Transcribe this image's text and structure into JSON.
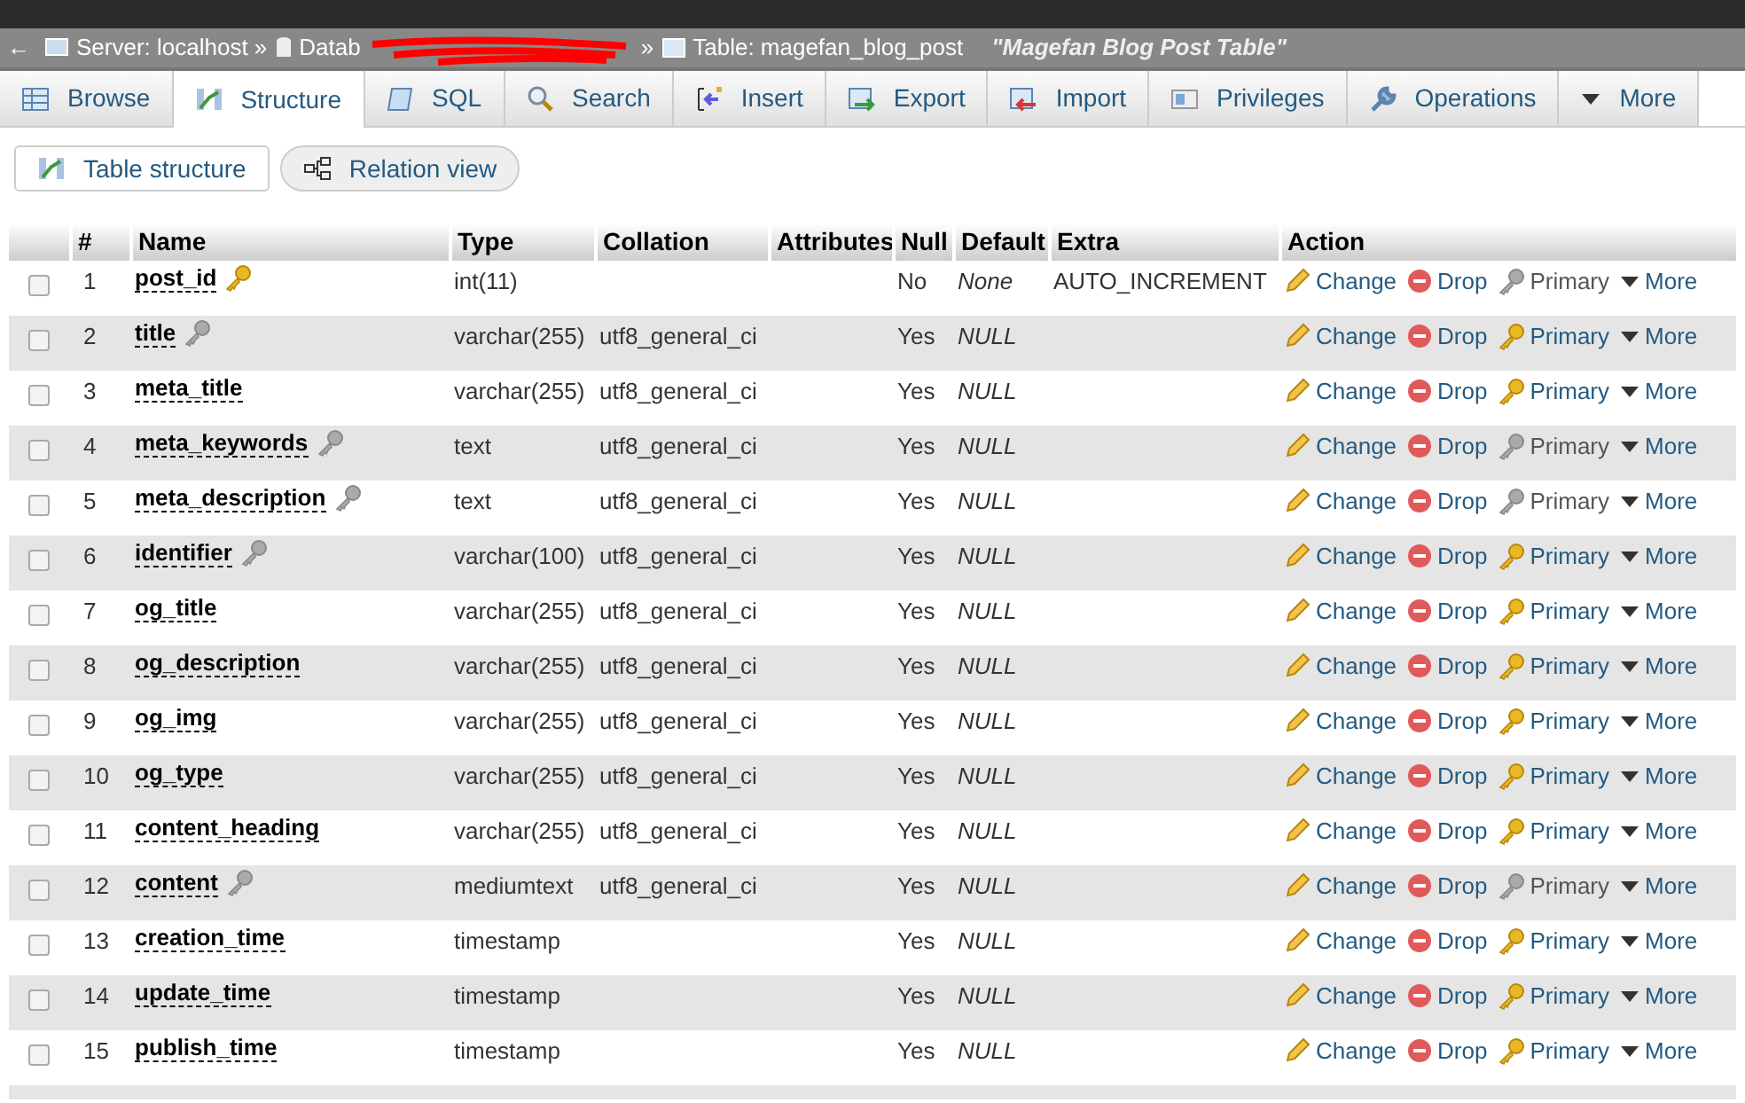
{
  "breadcrumb": {
    "back": "←",
    "server": "Server: localhost »",
    "database": "Datab",
    "separator": "»",
    "table": "Table: magefan_blog_post",
    "comment": "\"Magefan Blog Post Table\""
  },
  "tabs": [
    {
      "label": "Browse",
      "selected": false
    },
    {
      "label": "Structure",
      "selected": true
    },
    {
      "label": "SQL",
      "selected": false
    },
    {
      "label": "Search",
      "selected": false
    },
    {
      "label": "Insert",
      "selected": false
    },
    {
      "label": "Export",
      "selected": false
    },
    {
      "label": "Import",
      "selected": false
    },
    {
      "label": "Privileges",
      "selected": false
    },
    {
      "label": "Operations",
      "selected": false
    },
    {
      "label": "More",
      "selected": false
    }
  ],
  "subtabs": [
    {
      "label": "Table structure",
      "selected": true
    },
    {
      "label": "Relation view",
      "selected": false
    }
  ],
  "table": {
    "columns": [
      "#",
      "Name",
      "Type",
      "Collation",
      "Attributes",
      "Null",
      "Default",
      "Extra",
      "Action"
    ],
    "rows": [
      {
        "num": "1",
        "name": "post_id",
        "kind": "primary",
        "type": "int(11)",
        "collation": "",
        "null": "No",
        "default": "None",
        "extra": "AUTO_INCREMENT",
        "primary_enabled": false,
        "checked": false,
        "actions": [
          "Change",
          "Drop",
          "Primary",
          "More"
        ]
      },
      {
        "num": "2",
        "name": "title",
        "kind": "indexed",
        "type": "varchar(255)",
        "collation": "utf8_general_ci",
        "null": "Yes",
        "default": "NULL",
        "extra": "",
        "primary_enabled": true,
        "checked": false,
        "actions": [
          "Change",
          "Drop",
          "Primary",
          "More"
        ]
      },
      {
        "num": "3",
        "name": "meta_title",
        "kind": "plain",
        "type": "varchar(255)",
        "collation": "utf8_general_ci",
        "null": "Yes",
        "default": "NULL",
        "extra": "",
        "primary_enabled": true,
        "checked": false,
        "actions": [
          "Change",
          "Drop",
          "Primary",
          "More"
        ]
      },
      {
        "num": "4",
        "name": "meta_keywords",
        "kind": "indexed",
        "type": "text",
        "collation": "utf8_general_ci",
        "null": "Yes",
        "default": "NULL",
        "extra": "",
        "primary_enabled": false,
        "checked": false,
        "actions": [
          "Change",
          "Drop",
          "Primary",
          "More"
        ]
      },
      {
        "num": "5",
        "name": "meta_description",
        "kind": "indexed",
        "type": "text",
        "collation": "utf8_general_ci",
        "null": "Yes",
        "default": "NULL",
        "extra": "",
        "primary_enabled": false,
        "checked": false,
        "actions": [
          "Change",
          "Drop",
          "Primary",
          "More"
        ]
      },
      {
        "num": "6",
        "name": "identifier",
        "kind": "indexed",
        "type": "varchar(100)",
        "collation": "utf8_general_ci",
        "null": "Yes",
        "default": "NULL",
        "extra": "",
        "primary_enabled": true,
        "checked": false,
        "actions": [
          "Change",
          "Drop",
          "Primary",
          "More"
        ]
      },
      {
        "num": "7",
        "name": "og_title",
        "kind": "plain",
        "type": "varchar(255)",
        "collation": "utf8_general_ci",
        "null": "Yes",
        "default": "NULL",
        "extra": "",
        "primary_enabled": true,
        "checked": false,
        "actions": [
          "Change",
          "Drop",
          "Primary",
          "More"
        ]
      },
      {
        "num": "8",
        "name": "og_description",
        "kind": "plain",
        "type": "varchar(255)",
        "collation": "utf8_general_ci",
        "null": "Yes",
        "default": "NULL",
        "extra": "",
        "primary_enabled": true,
        "checked": false,
        "actions": [
          "Change",
          "Drop",
          "Primary",
          "More"
        ]
      },
      {
        "num": "9",
        "name": "og_img",
        "kind": "plain",
        "type": "varchar(255)",
        "collation": "utf8_general_ci",
        "null": "Yes",
        "default": "NULL",
        "extra": "",
        "primary_enabled": true,
        "checked": false,
        "actions": [
          "Change",
          "Drop",
          "Primary",
          "More"
        ]
      },
      {
        "num": "10",
        "name": "og_type",
        "kind": "plain",
        "type": "varchar(255)",
        "collation": "utf8_general_ci",
        "null": "Yes",
        "default": "NULL",
        "extra": "",
        "primary_enabled": true,
        "checked": false,
        "actions": [
          "Change",
          "Drop",
          "Primary",
          "More"
        ]
      },
      {
        "num": "11",
        "name": "content_heading",
        "kind": "plain",
        "type": "varchar(255)",
        "collation": "utf8_general_ci",
        "null": "Yes",
        "default": "NULL",
        "extra": "",
        "primary_enabled": true,
        "checked": false,
        "actions": [
          "Change",
          "Drop",
          "Primary",
          "More"
        ]
      },
      {
        "num": "12",
        "name": "content",
        "kind": "indexed",
        "type": "mediumtext",
        "collation": "utf8_general_ci",
        "null": "Yes",
        "default": "NULL",
        "extra": "",
        "primary_enabled": false,
        "checked": false,
        "actions": [
          "Change",
          "Drop",
          "Primary",
          "More"
        ]
      },
      {
        "num": "13",
        "name": "creation_time",
        "kind": "plain",
        "type": "timestamp",
        "collation": "",
        "null": "Yes",
        "default": "NULL",
        "extra": "",
        "primary_enabled": true,
        "checked": false,
        "actions": [
          "Change",
          "Drop",
          "Primary",
          "More"
        ]
      },
      {
        "num": "14",
        "name": "update_time",
        "kind": "plain",
        "type": "timestamp",
        "collation": "",
        "null": "Yes",
        "default": "NULL",
        "extra": "",
        "primary_enabled": true,
        "checked": false,
        "actions": [
          "Change",
          "Drop",
          "Primary",
          "More"
        ]
      },
      {
        "num": "15",
        "name": "publish_time",
        "kind": "plain",
        "type": "timestamp",
        "collation": "",
        "null": "Yes",
        "default": "NULL",
        "extra": "",
        "primary_enabled": true,
        "checked": false,
        "actions": [
          "Change",
          "Drop",
          "Primary",
          "More"
        ]
      }
    ]
  }
}
